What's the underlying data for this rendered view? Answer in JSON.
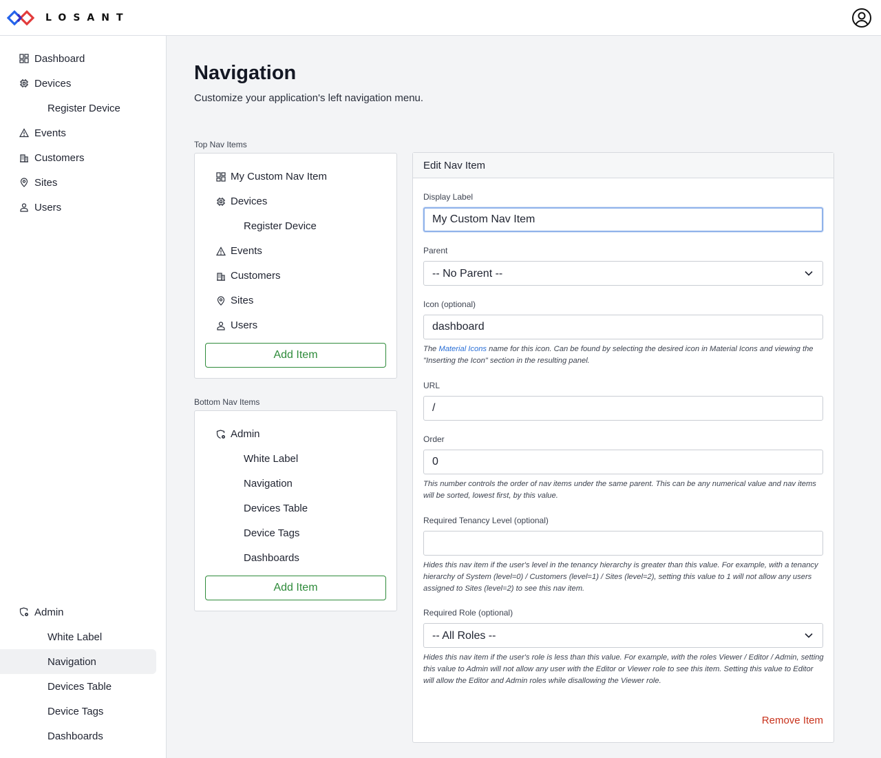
{
  "header": {
    "logo_text": "LOSANT",
    "account_icon": "account-circle-icon"
  },
  "sidebar": {
    "items": [
      {
        "label": "Dashboard",
        "icon": "dashboard-icon"
      },
      {
        "label": "Devices",
        "icon": "chip-icon"
      },
      {
        "label": "Register Device"
      },
      {
        "label": "Events",
        "icon": "warning-icon"
      },
      {
        "label": "Customers",
        "icon": "building-icon"
      },
      {
        "label": "Sites",
        "icon": "location-pin-icon"
      },
      {
        "label": "Users",
        "icon": "user-icon"
      }
    ],
    "admin": {
      "label": "Admin",
      "icon": "admin-shield-icon",
      "children": [
        "White Label",
        "Navigation",
        "Devices Table",
        "Device Tags",
        "Dashboards"
      ],
      "active": "Navigation"
    }
  },
  "page": {
    "title": "Navigation",
    "subtitle": "Customize your application's left navigation menu."
  },
  "top_nav": {
    "label": "Top Nav Items",
    "items": [
      {
        "label": "My Custom Nav Item",
        "icon": "dashboard-icon"
      },
      {
        "label": "Devices",
        "icon": "chip-icon"
      },
      {
        "label": "Register Device"
      },
      {
        "label": "Events",
        "icon": "warning-icon"
      },
      {
        "label": "Customers",
        "icon": "building-icon"
      },
      {
        "label": "Sites",
        "icon": "location-pin-icon"
      },
      {
        "label": "Users",
        "icon": "user-icon"
      }
    ],
    "add_label": "Add Item"
  },
  "bottom_nav": {
    "label": "Bottom Nav Items",
    "items": [
      {
        "label": "Admin",
        "icon": "admin-shield-icon"
      },
      {
        "label": "White Label"
      },
      {
        "label": "Navigation"
      },
      {
        "label": "Devices Table"
      },
      {
        "label": "Device Tags"
      },
      {
        "label": "Dashboards"
      }
    ],
    "add_label": "Add Item"
  },
  "edit": {
    "title": "Edit Nav Item",
    "display_label": {
      "label": "Display Label",
      "value": "My Custom Nav Item"
    },
    "parent": {
      "label": "Parent",
      "value": "-- No Parent --"
    },
    "icon": {
      "label": "Icon (optional)",
      "value": "dashboard",
      "help_prefix": "The ",
      "help_link": "Material Icons",
      "help_suffix": " name for this icon. Can be found by selecting the desired icon in Material Icons and viewing the \"Inserting the Icon\" section in the resulting panel."
    },
    "url": {
      "label": "URL",
      "value": "/"
    },
    "order": {
      "label": "Order",
      "value": "0",
      "help": "This number controls the order of nav items under the same parent. This can be any numerical value and nav items will be sorted, lowest first, by this value."
    },
    "tenancy": {
      "label": "Required Tenancy Level (optional)",
      "value": "",
      "help": "Hides this nav item if the user's level in the tenancy hierarchy is greater than this value. For example, with a tenancy hierarchy of System (level=0) / Customers (level=1) / Sites (level=2), setting this value to 1 will not allow any users assigned to Sites (level=2) to see this nav item."
    },
    "role": {
      "label": "Required Role (optional)",
      "value": "-- All Roles --",
      "help": "Hides this nav item if the user's role is less than this value. For example, with the roles Viewer / Editor / Admin, setting this value to Admin will not allow any user with the Editor or Viewer role to see this item. Setting this value to Editor will allow the Editor and Admin roles while disallowing the Viewer role."
    },
    "remove_label": "Remove Item"
  }
}
